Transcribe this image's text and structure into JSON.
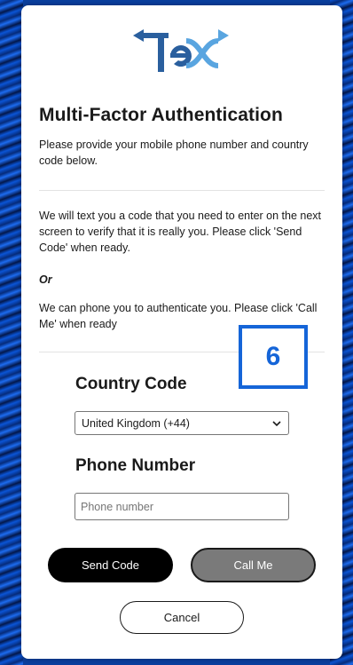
{
  "brand": {
    "logo_name": "TeX logo",
    "accent": "#1565d8",
    "logo_blue": "#2a5f9e",
    "logo_light": "#59a5e0"
  },
  "title": "Multi-Factor Authentication",
  "intro": "Please provide your mobile phone number and country code below.",
  "sms_text": "We will text you a code that you need to enter on the next screen to verify that it is really you. Please click 'Send Code' when ready.",
  "or_text": "Or",
  "call_text": "We can phone you to authenticate you. Please click 'Call Me' when ready",
  "step_badge": "6",
  "country": {
    "label": "Country Code",
    "selected": "United Kingdom (+44)"
  },
  "phone": {
    "label": "Phone Number",
    "placeholder": "Phone number",
    "value": ""
  },
  "buttons": {
    "send": "Send Code",
    "call": "Call Me",
    "cancel": "Cancel"
  }
}
